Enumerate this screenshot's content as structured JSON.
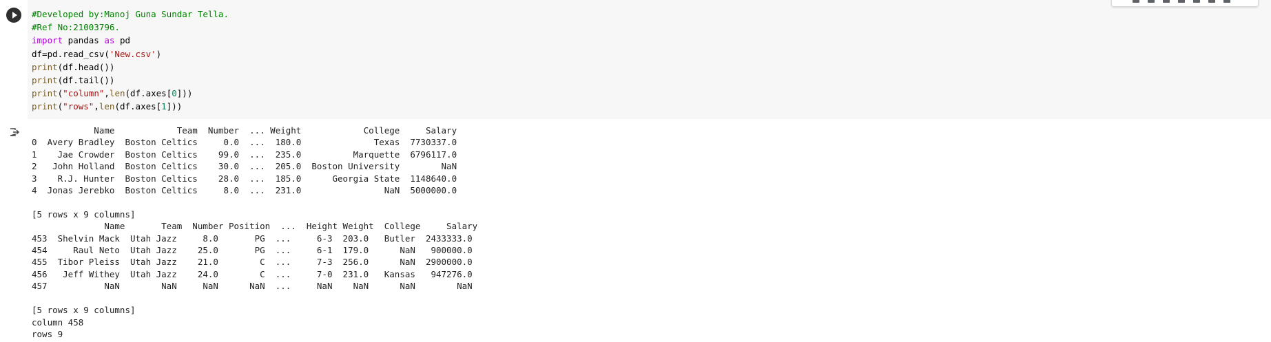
{
  "code_cell": {
    "lines": [
      {
        "segments": [
          {
            "text": "#Developed by:Manoj Guna Sundar Tella.",
            "kind": "comment"
          }
        ]
      },
      {
        "segments": [
          {
            "text": "#Ref No:21003796.",
            "kind": "comment"
          }
        ]
      },
      {
        "segments": [
          {
            "text": "import",
            "kind": "kw"
          },
          {
            "text": " pandas ",
            "kind": "plain"
          },
          {
            "text": "as",
            "kind": "kw"
          },
          {
            "text": " pd",
            "kind": "plain"
          }
        ]
      },
      {
        "segments": [
          {
            "text": "df=pd.read_csv(",
            "kind": "plain"
          },
          {
            "text": "'New.csv'",
            "kind": "str"
          },
          {
            "text": ")",
            "kind": "plain"
          }
        ]
      },
      {
        "segments": [
          {
            "text": "print",
            "kind": "builtin"
          },
          {
            "text": "(df.head())",
            "kind": "plain"
          }
        ]
      },
      {
        "segments": [
          {
            "text": "print",
            "kind": "builtin"
          },
          {
            "text": "(df.tail())",
            "kind": "plain"
          }
        ]
      },
      {
        "segments": [
          {
            "text": "print",
            "kind": "builtin"
          },
          {
            "text": "(",
            "kind": "plain"
          },
          {
            "text": "\"column\"",
            "kind": "str"
          },
          {
            "text": ",",
            "kind": "plain"
          },
          {
            "text": "len",
            "kind": "builtin"
          },
          {
            "text": "(df.axes[",
            "kind": "plain"
          },
          {
            "text": "0",
            "kind": "num"
          },
          {
            "text": "]))",
            "kind": "plain"
          }
        ]
      },
      {
        "segments": [
          {
            "text": "print",
            "kind": "builtin"
          },
          {
            "text": "(",
            "kind": "plain"
          },
          {
            "text": "\"rows\"",
            "kind": "str"
          },
          {
            "text": ",",
            "kind": "plain"
          },
          {
            "text": "len",
            "kind": "builtin"
          },
          {
            "text": "(df.axes[",
            "kind": "plain"
          },
          {
            "text": "1",
            "kind": "num"
          },
          {
            "text": "]))",
            "kind": "plain"
          }
        ]
      }
    ]
  },
  "output": {
    "lines": [
      "            Name            Team  Number  ... Weight            College     Salary",
      "0  Avery Bradley  Boston Celtics     0.0  ...  180.0              Texas  7730337.0",
      "1    Jae Crowder  Boston Celtics    99.0  ...  235.0          Marquette  6796117.0",
      "2   John Holland  Boston Celtics    30.0  ...  205.0  Boston University        NaN",
      "3    R.J. Hunter  Boston Celtics    28.0  ...  185.0      Georgia State  1148640.0",
      "4  Jonas Jerebko  Boston Celtics     8.0  ...  231.0                NaN  5000000.0",
      "",
      "[5 rows x 9 columns]",
      "              Name       Team  Number Position  ...  Height Weight  College     Salary",
      "453  Shelvin Mack  Utah Jazz     8.0       PG  ...     6-3  203.0   Butler  2433333.0",
      "454     Raul Neto  Utah Jazz    25.0       PG  ...     6-1  179.0      NaN   900000.0",
      "455  Tibor Pleiss  Utah Jazz    21.0        C  ...     7-3  256.0      NaN  2900000.0",
      "456   Jeff Withey  Utah Jazz    24.0        C  ...     7-0  231.0   Kansas   947276.0",
      "457           NaN        NaN     NaN      NaN  ...     NaN    NaN      NaN        NaN",
      "",
      "[5 rows x 9 columns]",
      "column 458",
      "rows 9"
    ]
  },
  "icons": {
    "run": "play-icon",
    "output": "output-redirect-icon"
  },
  "colors": {
    "comment": "#008000",
    "keyword": "#af00db",
    "string": "#a31515",
    "builtin": "#795e26",
    "number": "#098658",
    "code_background": "#f7f7f7"
  }
}
